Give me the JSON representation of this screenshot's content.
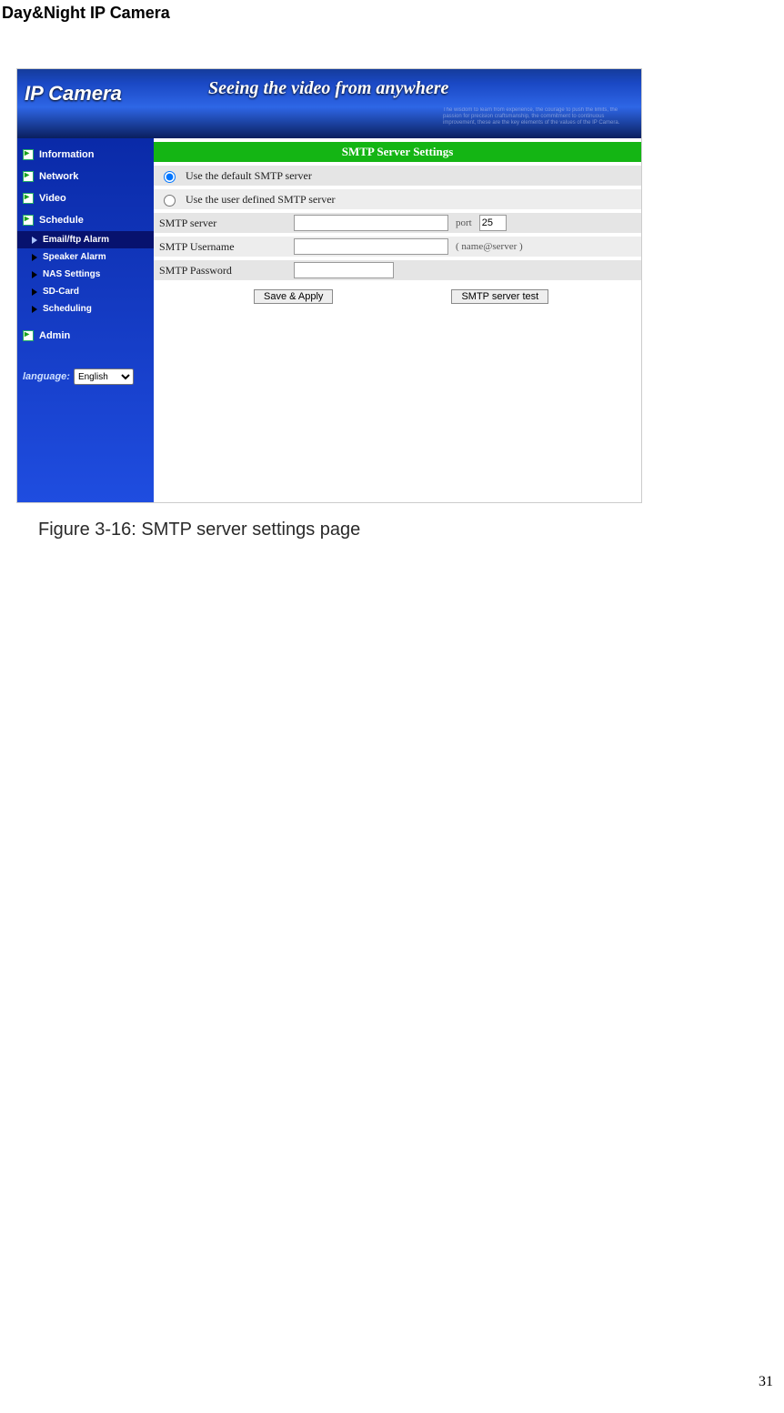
{
  "page_header": "Day&Night IP Camera",
  "banner": {
    "logo": "IP Camera",
    "slogan": "Seeing the video from anywhere",
    "fineprint": "The wisdom to learn from experience,\nthe courage to push the limits,\nthe passion for precision craftsmanship,\nthe commitment to continuous improvement,\nthese are the key elements of the values of the IP Camera."
  },
  "sidebar": {
    "top": [
      {
        "label": "Information"
      },
      {
        "label": "Network"
      },
      {
        "label": "Video"
      },
      {
        "label": "Schedule"
      }
    ],
    "sub": [
      {
        "label": "Email/ftp Alarm",
        "active": true
      },
      {
        "label": "Speaker Alarm"
      },
      {
        "label": "NAS Settings"
      },
      {
        "label": "SD-Card"
      },
      {
        "label": "Scheduling"
      }
    ],
    "bottom": [
      {
        "label": "Admin"
      }
    ],
    "language_label": "language:",
    "language_value": "English"
  },
  "content": {
    "title": "SMTP Server Settings",
    "radio_default": "Use the default SMTP server",
    "radio_user": "Use the user defined SMTP server",
    "row_server_label": "SMTP server",
    "row_server_value": "",
    "row_port_label": "port",
    "row_port_value": "25",
    "row_username_label": "SMTP Username",
    "row_username_value": "",
    "row_username_hint": "( name@server )",
    "row_password_label": "SMTP Password",
    "row_password_value": "",
    "btn_save": "Save & Apply",
    "btn_test": "SMTP server test"
  },
  "caption": "Figure 3-16: SMTP server settings page",
  "page_number": "31"
}
